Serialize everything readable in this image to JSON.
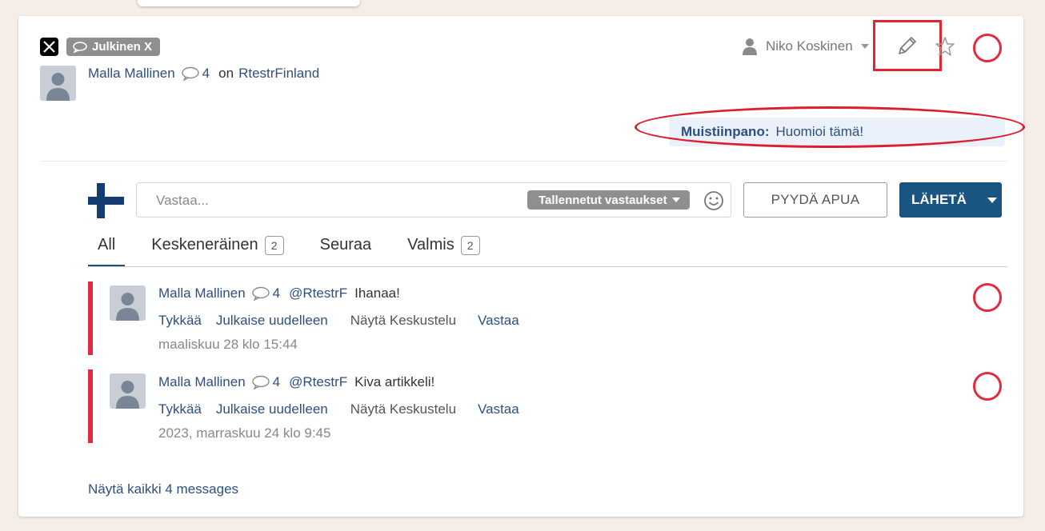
{
  "post": {
    "channel_badge": "Julkinen X",
    "author": "Malla Mallinen",
    "comment_count": "4",
    "on_text": "on",
    "page": "RtestrFinland",
    "assignee": "Niko Koskinen",
    "note_label": "Muistiinpano:",
    "note_text": "Huomioi tämä!"
  },
  "reply": {
    "placeholder": "Vastaa...",
    "saved_replies_label": "Tallennetut vastaukset",
    "help_button": "PYYDÄ APUA",
    "send_button": "LÄHETÄ"
  },
  "tabs": [
    {
      "label": "All",
      "count": ""
    },
    {
      "label": "Keskeneräinen",
      "count": "2"
    },
    {
      "label": "Seuraa",
      "count": ""
    },
    {
      "label": "Valmis",
      "count": "2"
    }
  ],
  "messages": [
    {
      "author": "Malla Mallinen",
      "count": "4",
      "handle": "@RtestrF",
      "text": "Ihanaa!",
      "actions": [
        "Tykkää",
        "Julkaise uudelleen",
        "Näytä Keskustelu",
        "Vastaa"
      ],
      "date": "maaliskuu 28 klo 15:44"
    },
    {
      "author": "Malla Mallinen",
      "count": "4",
      "handle": "@RtestrF",
      "text": "Kiva artikkeli!",
      "actions": [
        "Tykkää",
        "Julkaise uudelleen",
        "Näytä Keskustelu",
        "Vastaa"
      ],
      "date": "2023, marraskuu 24 klo 9:45"
    }
  ],
  "show_all": "Näytä kaikki 4 messages",
  "colors": {
    "accent": "#1a5480",
    "link": "#2e4f7f",
    "alert": "#e22a40",
    "background": "#f5ede8"
  }
}
